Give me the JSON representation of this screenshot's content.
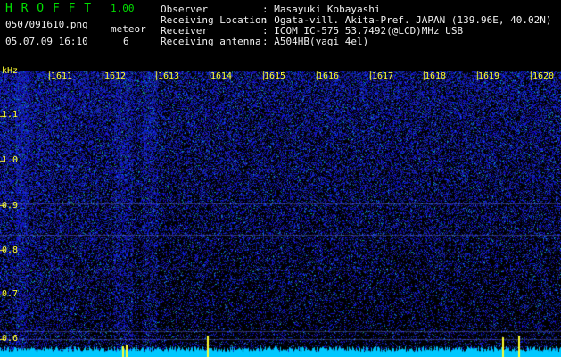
{
  "header": {
    "app_name": "H R O F F T",
    "version": "1.00",
    "filename": "0507091610.png",
    "meteor_label": "meteor",
    "datetime": "05.07.09 16:10",
    "meteor_count": "6"
  },
  "info": {
    "rows": [
      {
        "label": "Observer",
        "value": ": Masayuki Kobayashi"
      },
      {
        "label": "Receiving Location",
        "value": ": Ogata-vill. Akita-Pref. JAPAN (139.96E, 40.02N)"
      },
      {
        "label": "Receiver",
        "value": ": ICOM IC-575 53.7492(@LCD)MHz USB"
      },
      {
        "label": "Receiving antenna",
        "value": ": A504HB(yagi 4el)"
      }
    ]
  },
  "axis": {
    "unit": "kHz",
    "y_ticks": [
      "1.1",
      "1.0",
      "0.9",
      "0.8",
      "0.7",
      "0.6"
    ],
    "x_ticks": [
      "1611",
      "1612",
      "1613",
      "1614",
      "1615",
      "1616",
      "1617",
      "1618",
      "1619",
      "1620"
    ]
  },
  "colors": {
    "background": "#000000",
    "noise": "#1a2fd0",
    "text_green": "#00e000",
    "text_yellow": "#ffff30",
    "baseline": "#00c8ff"
  }
}
